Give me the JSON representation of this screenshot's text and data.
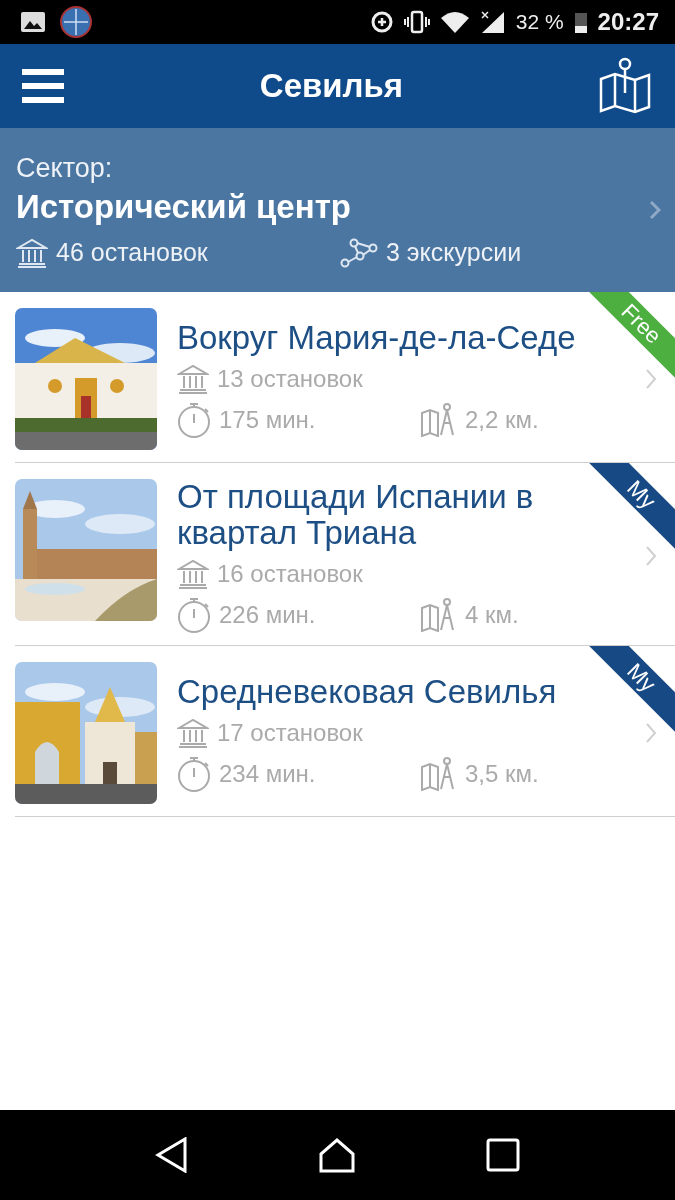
{
  "status_bar": {
    "battery": "32 %",
    "time": "20:27"
  },
  "app_bar": {
    "title": "Севилья"
  },
  "sector": {
    "label": "Сектор:",
    "name": "Исторический центр",
    "stops": "46 остановок",
    "tours": "3 экскурсии"
  },
  "tours": [
    {
      "title": "Вокруг Мария-де-ла-Седе",
      "stops": "13 остановок",
      "duration": "175 мин.",
      "distance": "2,2 км.",
      "ribbon": {
        "kind": "free",
        "label": "Free"
      }
    },
    {
      "title": "От площади Испании в квартал Триана",
      "stops": "16 остановок",
      "duration": "226 мин.",
      "distance": "4 км.",
      "ribbon": {
        "kind": "my",
        "label": "My"
      }
    },
    {
      "title": "Средневековая Севилья",
      "stops": "17 остановок",
      "duration": "234 мин.",
      "distance": "3,5 км.",
      "ribbon": {
        "kind": "my",
        "label": "My"
      }
    }
  ]
}
